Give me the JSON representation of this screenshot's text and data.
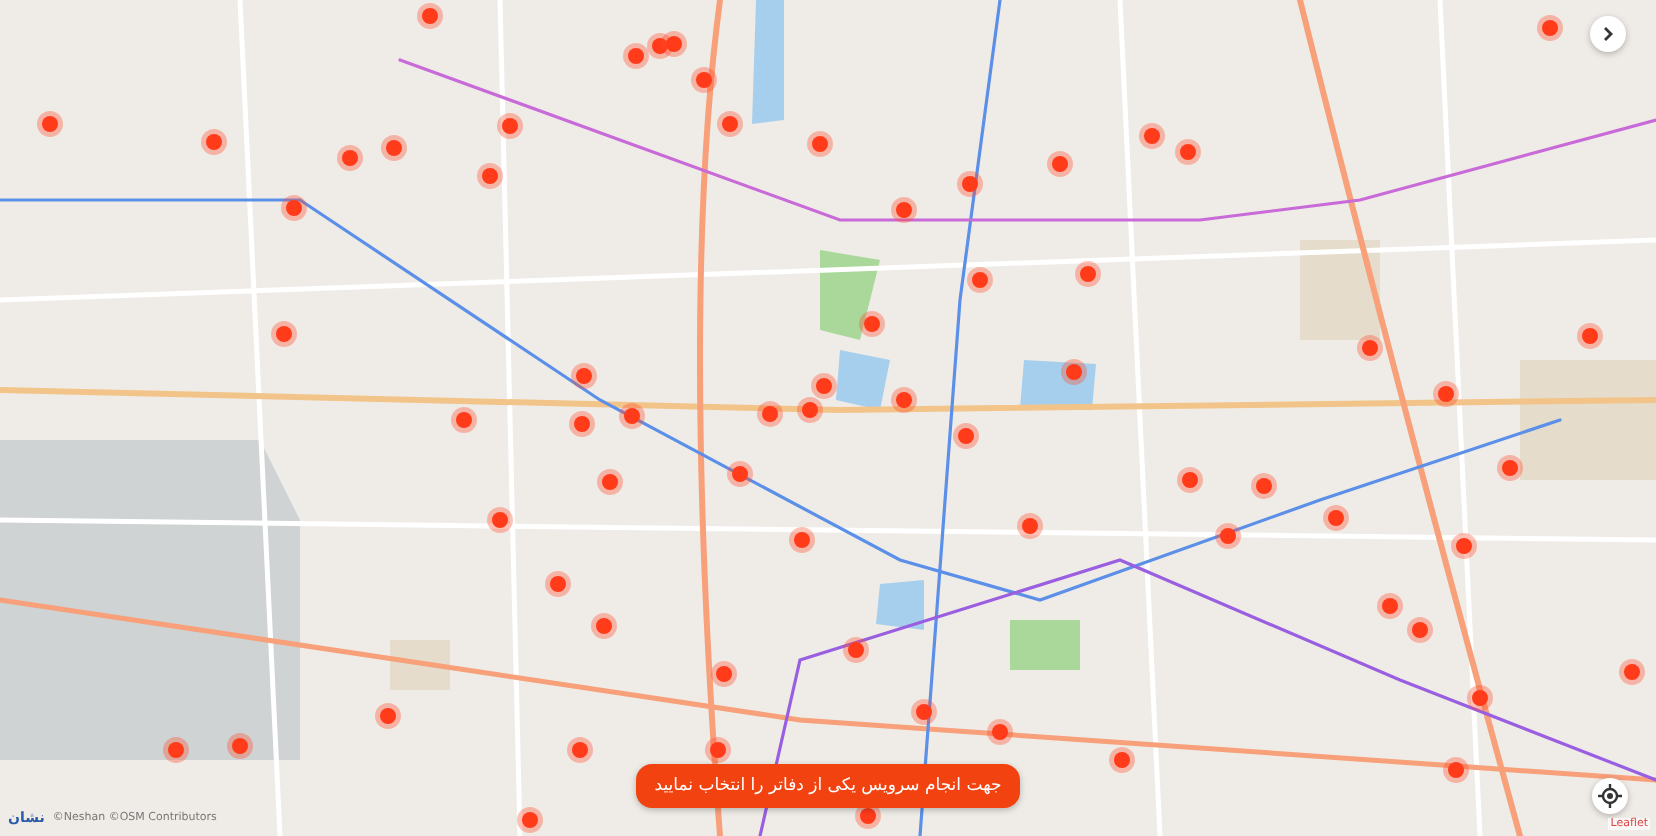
{
  "map": {
    "logo": "نشان",
    "attribution": "©Neshan ©OSM Contributors",
    "leaflet_link": "Leaflet"
  },
  "notice": "جهت انجام سرویس یکی از دفاتر را انتخاب نمایید"
}
